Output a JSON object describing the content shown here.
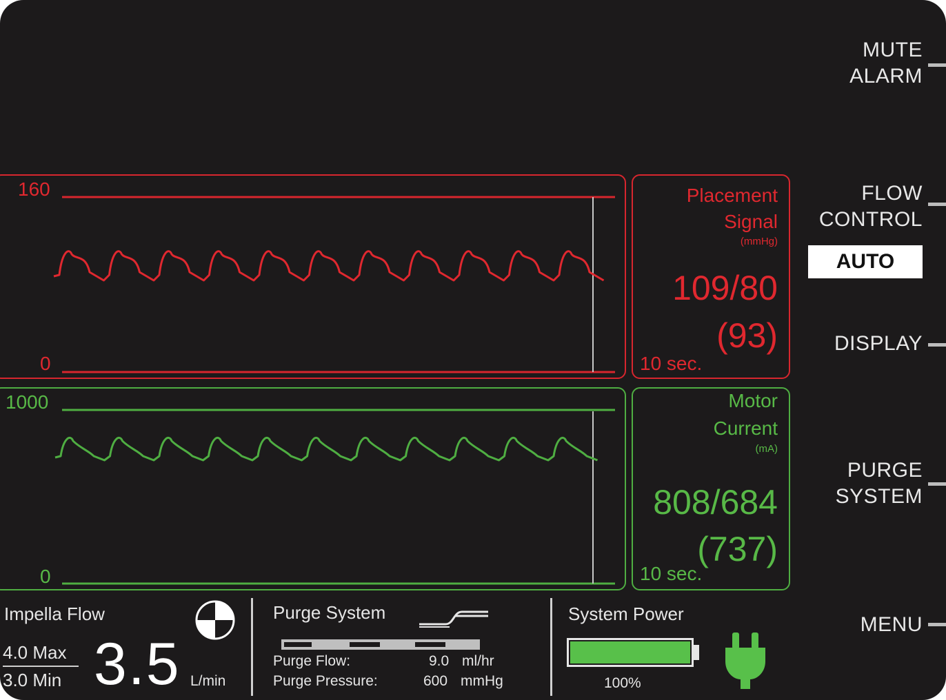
{
  "softkeys": {
    "mute": [
      "MUTE",
      "ALARM"
    ],
    "flow_control": [
      "FLOW",
      "CONTROL"
    ],
    "flow_mode": "AUTO",
    "display": "DISPLAY",
    "purge": [
      "PURGE",
      "SYSTEM"
    ],
    "menu": "MENU"
  },
  "placement_signal": {
    "axis_max": "160",
    "axis_min": "0",
    "label_line1": "Placement",
    "label_line2": "Signal",
    "unit": "(mmHg)",
    "value": "109/80",
    "mean": "(93)",
    "time_window": "10 sec.",
    "color": "#d8262e"
  },
  "motor_current": {
    "axis_max": "1000",
    "axis_min": "0",
    "label_line1": "Motor",
    "label_line2": "Current",
    "unit": "(mA)",
    "value": "808/684",
    "mean": "(737)",
    "time_window": "10 sec.",
    "color": "#4fae42"
  },
  "impella_flow": {
    "title": "Impella  Flow",
    "max": "4.0 Max",
    "min": "3.0 Min",
    "value": "3.5",
    "unit": "L/min"
  },
  "purge_system": {
    "title": "Purge System",
    "flow_label": "Purge Flow:",
    "flow_value": "9.0",
    "flow_unit": "ml/hr",
    "pressure_label": "Purge Pressure:",
    "pressure_value": "600",
    "pressure_unit": "mmHg"
  },
  "system_power": {
    "title": "System Power",
    "level_text": "100%",
    "level": 1.0,
    "battery_color": "#58c04a",
    "plug_color": "#58c04a"
  },
  "icons": [
    "rotor-icon",
    "purge-curve-icon",
    "battery-icon",
    "plug-icon"
  ]
}
